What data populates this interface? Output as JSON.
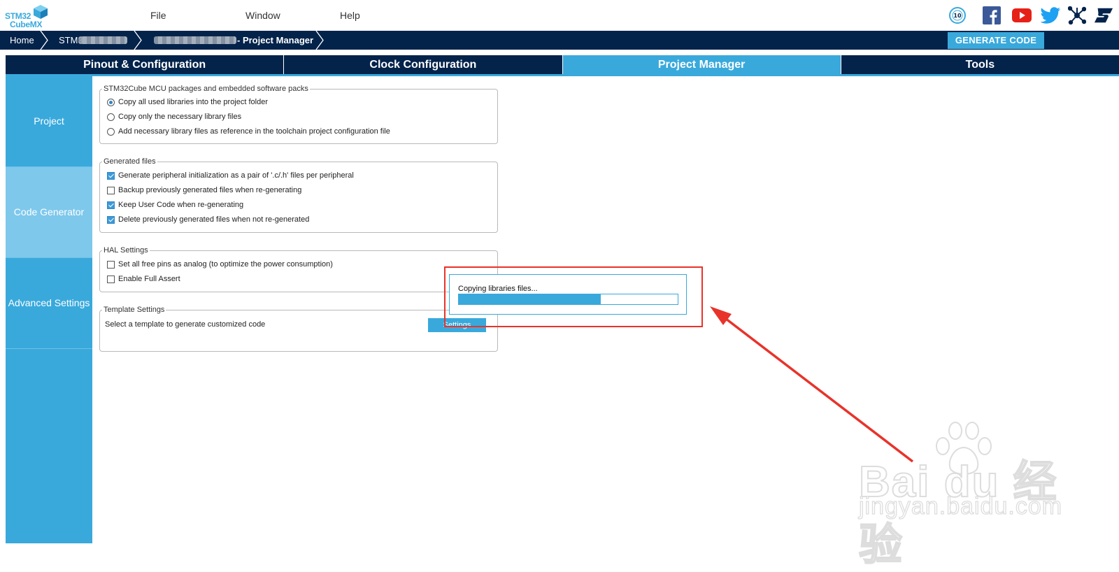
{
  "app": {
    "logo_line1": "STM32",
    "logo_line2": "CubeMX"
  },
  "menu": {
    "file": "File",
    "window": "Window",
    "help": "Help"
  },
  "social_icons": [
    "anniversary-badge-icon",
    "facebook-icon",
    "youtube-icon",
    "twitter-icon",
    "network-icon",
    "st-logo-icon"
  ],
  "breadcrumb": {
    "home": "Home",
    "item2": "STM3",
    "item3": "- Project Manager"
  },
  "toolbar": {
    "generate_label": "GENERATE CODE"
  },
  "tabs": [
    {
      "label": "Pinout & Configuration",
      "active": false
    },
    {
      "label": "Clock Configuration",
      "active": false
    },
    {
      "label": "Project Manager",
      "active": true
    },
    {
      "label": "Tools",
      "active": false
    }
  ],
  "sidebar": {
    "items": [
      {
        "label": "Project"
      },
      {
        "label": "Code Generator"
      },
      {
        "label": "Advanced Settings"
      }
    ]
  },
  "packages": {
    "legend": "STM32Cube MCU packages and embedded software packs",
    "options": [
      {
        "label": "Copy all used libraries into the project folder",
        "selected": true
      },
      {
        "label": "Copy only the necessary library files",
        "selected": false
      },
      {
        "label": "Add necessary library files as reference in the toolchain project configuration file",
        "selected": false
      }
    ]
  },
  "generated_files": {
    "legend": "Generated files",
    "options": [
      {
        "label": "Generate peripheral initialization as a pair of '.c/.h' files per peripheral",
        "checked": true
      },
      {
        "label": "Backup previously generated files when re-generating",
        "checked": false
      },
      {
        "label": "Keep User Code when re-generating",
        "checked": true
      },
      {
        "label": "Delete previously generated files when not re-generated",
        "checked": true
      }
    ]
  },
  "hal_settings": {
    "legend": "HAL Settings",
    "options": [
      {
        "label": "Set all free pins as analog (to optimize the power consumption)",
        "checked": false
      },
      {
        "label": "Enable Full Assert",
        "checked": false
      }
    ]
  },
  "template_settings": {
    "legend": "Template Settings",
    "description": "Select a template to generate customized code",
    "button_label": "Settings"
  },
  "progress_dialog": {
    "message": "Copying libraries files...",
    "progress": 0.65
  },
  "watermark": {
    "brand": "Bai du 经验",
    "url": "jingyan.baidu.com"
  },
  "colors": {
    "navy": "#03234b",
    "accent": "#39a9dc",
    "annotation_red": "#e8332b"
  }
}
